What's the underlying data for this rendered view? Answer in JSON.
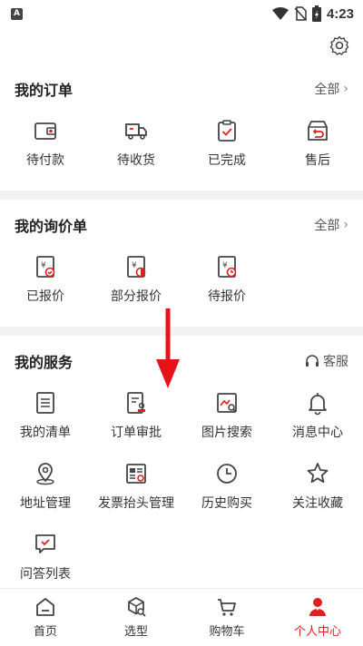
{
  "status_bar": {
    "time": "4:23",
    "left_icon_letter": "A"
  },
  "orders": {
    "title": "我的订单",
    "all_label": "全部",
    "items": [
      {
        "label": "待付款",
        "icon": "wallet-icon"
      },
      {
        "label": "待收货",
        "icon": "truck-icon"
      },
      {
        "label": "已完成",
        "icon": "clipboard-check-icon"
      },
      {
        "label": "售后",
        "icon": "return-box-icon"
      }
    ]
  },
  "inquiries": {
    "title": "我的询价单",
    "all_label": "全部",
    "items": [
      {
        "label": "已报价",
        "icon": "quote-done-icon"
      },
      {
        "label": "部分报价",
        "icon": "quote-partial-icon"
      },
      {
        "label": "待报价",
        "icon": "quote-pending-icon"
      }
    ]
  },
  "services": {
    "title": "我的服务",
    "support_label": "客服",
    "items": [
      {
        "label": "我的清单",
        "icon": "list-doc-icon"
      },
      {
        "label": "订单审批",
        "icon": "approval-icon"
      },
      {
        "label": "图片搜索",
        "icon": "image-search-icon"
      },
      {
        "label": "消息中心",
        "icon": "bell-icon"
      },
      {
        "label": "地址管理",
        "icon": "location-icon"
      },
      {
        "label": "发票抬头管理",
        "icon": "invoice-icon"
      },
      {
        "label": "历史购买",
        "icon": "clock-icon"
      },
      {
        "label": "关注收藏",
        "icon": "star-icon"
      },
      {
        "label": "问答列表",
        "icon": "chat-check-icon"
      }
    ]
  },
  "tabbar": {
    "items": [
      {
        "label": "首页",
        "icon": "home-icon"
      },
      {
        "label": "选型",
        "icon": "cube-search-icon"
      },
      {
        "label": "购物车",
        "icon": "cart-icon"
      },
      {
        "label": "个人中心",
        "icon": "profile-icon",
        "active": true
      }
    ]
  },
  "colors": {
    "accent": "#e02020",
    "icon": "#444444",
    "divider": "#f2f2f2"
  }
}
